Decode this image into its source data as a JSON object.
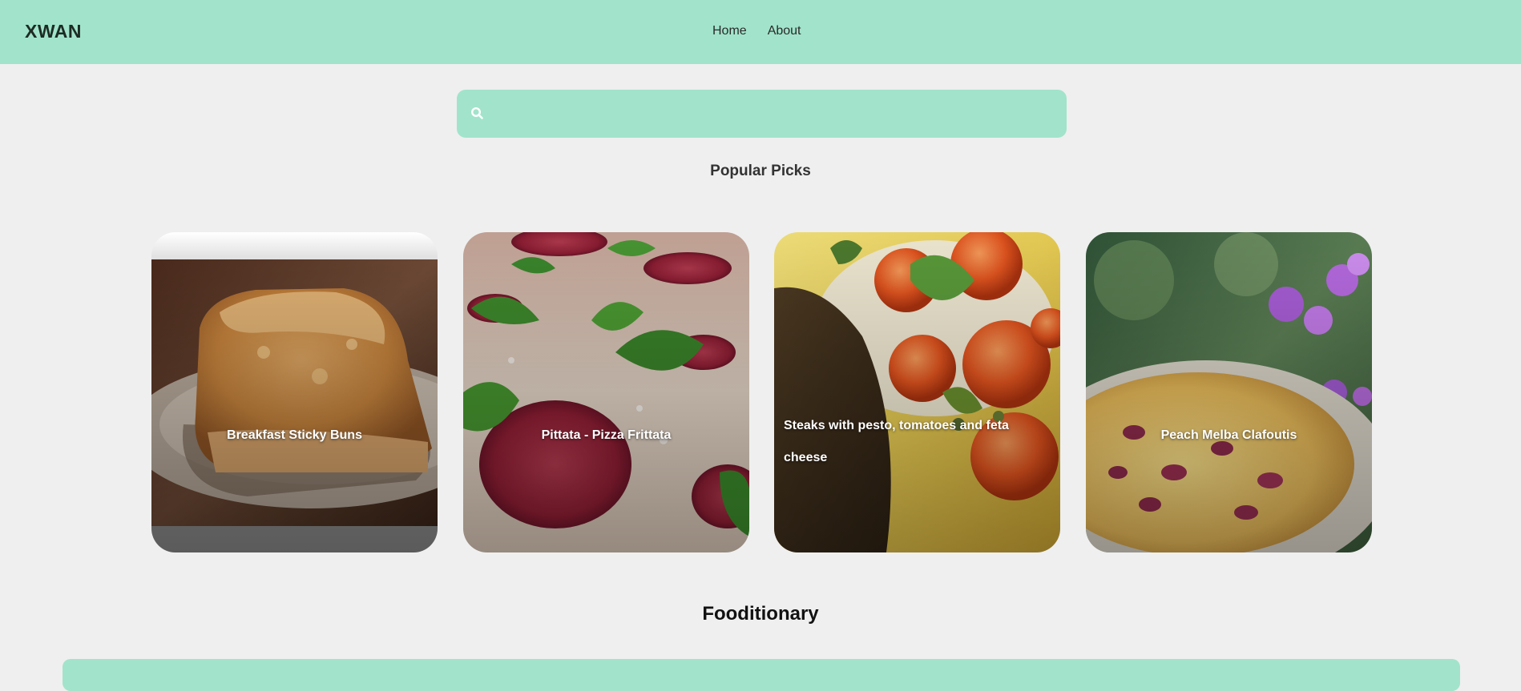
{
  "header": {
    "brand": "XWAN",
    "nav": [
      {
        "label": "Home"
      },
      {
        "label": "About"
      }
    ]
  },
  "search": {
    "placeholder": "",
    "value": "",
    "icon": "search-icon"
  },
  "popular": {
    "title": "Popular Picks",
    "cards": [
      {
        "label": "Breakfast Sticky Buns"
      },
      {
        "label": "Pittata - Pizza Frittata"
      },
      {
        "label": "Steaks with pesto, tomatoes and feta cheese"
      },
      {
        "label": "Peach Melba Clafoutis"
      }
    ]
  },
  "fooditionary": {
    "title": "Fooditionary"
  },
  "colors": {
    "accent": "#a1e4cb",
    "background": "#efefef"
  }
}
